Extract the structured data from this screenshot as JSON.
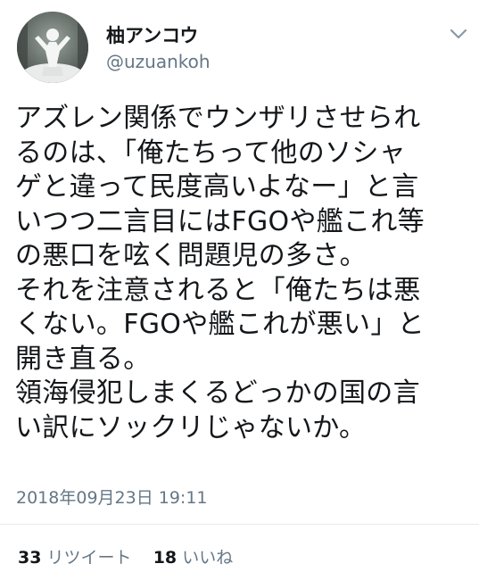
{
  "user": {
    "display_name": "柚アンコウ",
    "handle": "@uzuankoh"
  },
  "tweet": {
    "lines": [
      "アズレン関係でウンザリさせられ",
      "るのは、「俺たちって他のソシャ",
      "ゲと違って民度高いよなー」と言",
      "いつつ二言目にはFGOや艦これ等",
      "の悪口を呟く問題児の多さ。",
      "それを注意されると「俺たちは悪",
      "くない。FGOや艦これが悪い」と",
      "開き直る。",
      "領海侵犯しまくるどっかの国の言",
      "い訳にソックリじゃないか。"
    ],
    "timestamp": "2018年09月23日 19:11"
  },
  "stats": {
    "retweets_count": "33",
    "retweets_label": "リツイート",
    "likes_count": "18",
    "likes_label": "いいね"
  },
  "icons": {
    "menu": "chevron-down-icon"
  },
  "colors": {
    "text": "#14171a",
    "secondary": "#657786",
    "divider": "#e6ecf0"
  }
}
